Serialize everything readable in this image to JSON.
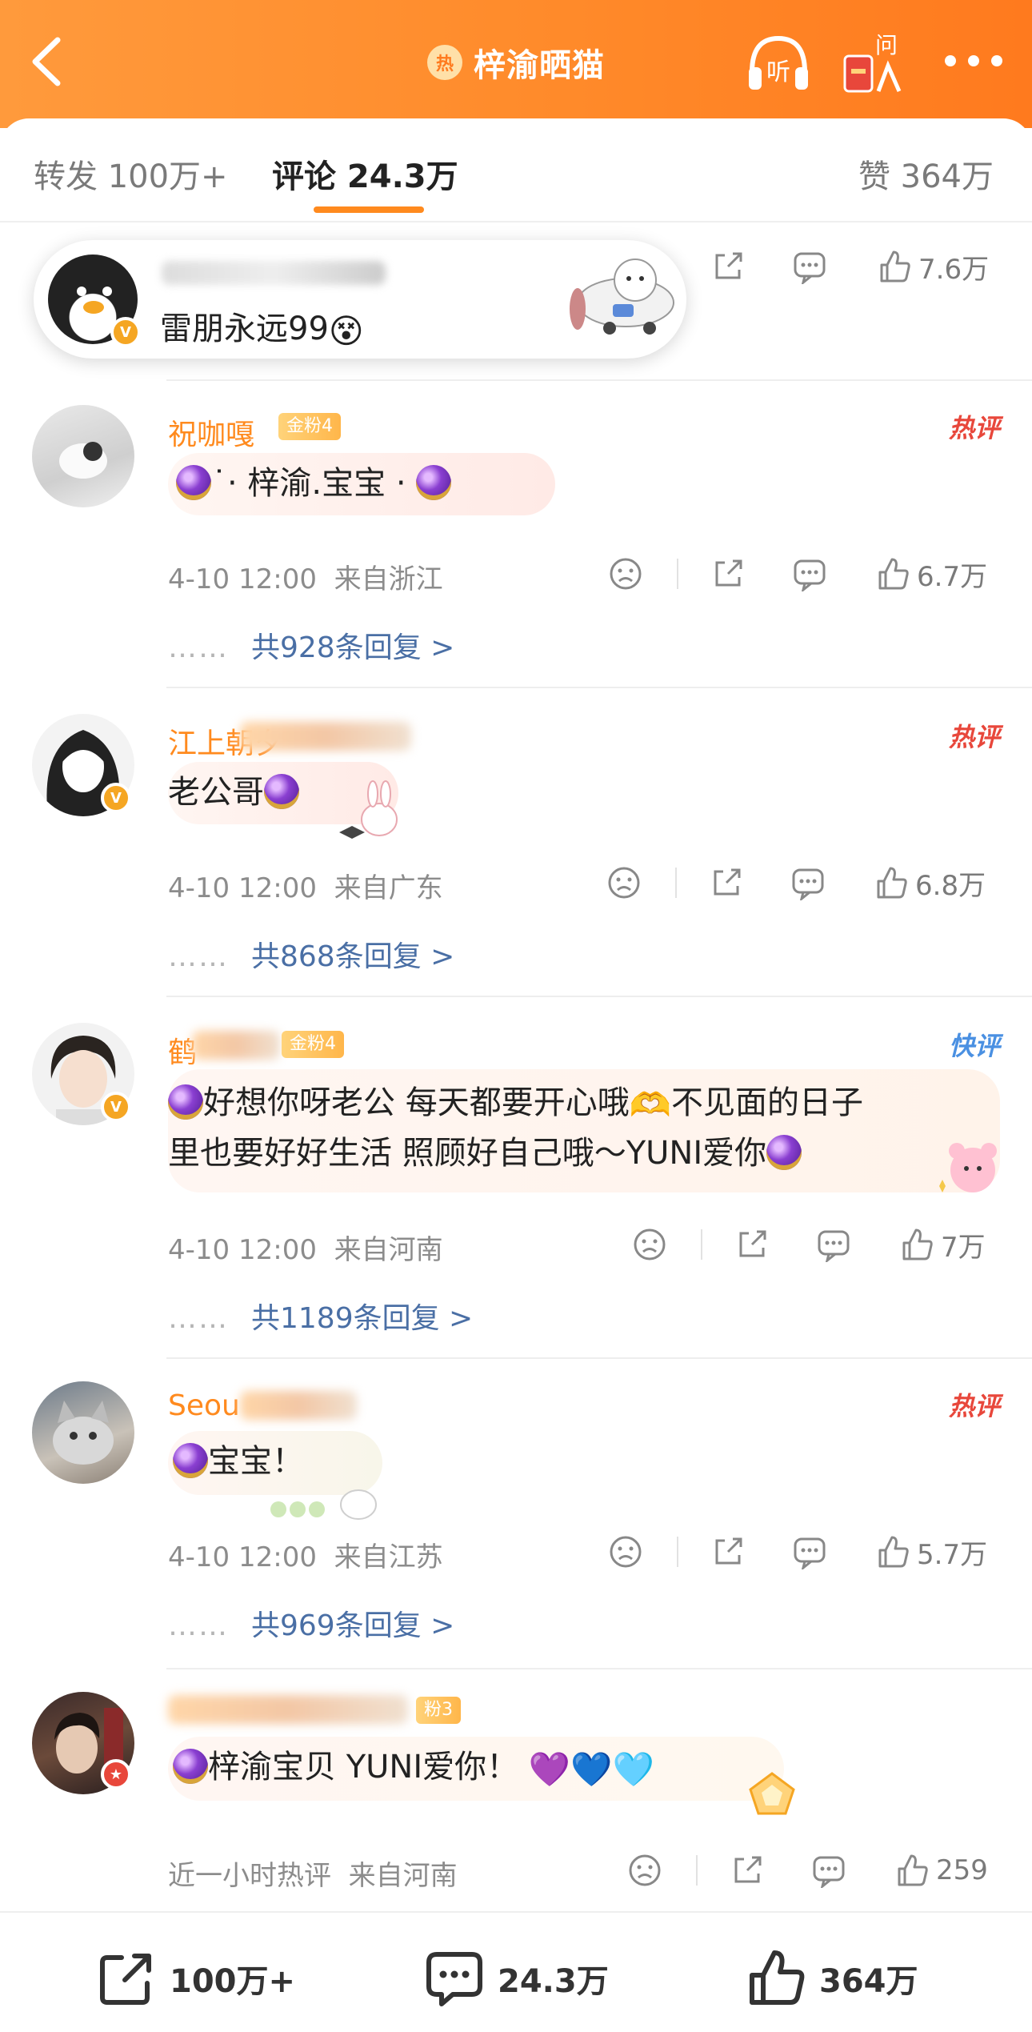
{
  "header": {
    "title": "梓渝晒猫",
    "hot_badge": "热",
    "ask_label": "问",
    "listen_label": "听",
    "gradient": [
      "#ff9a3c",
      "#ff7a1e"
    ]
  },
  "tabs": {
    "repost": "转发 100万+",
    "comment": "评论 24.3万",
    "like": "赞 364万",
    "active_color": "#ff8a1e"
  },
  "pill": {
    "text": "雷朋永远99",
    "like_count": "7.6万"
  },
  "comments": [
    {
      "name": "祝咖嘎",
      "fan_badge": "金粉4",
      "tag": "热评",
      "text": "˙· 梓渝.宝宝 ·",
      "time": "4-10 12:00",
      "location": "来自浙江",
      "likes": "6.7万",
      "replies": "共928条回复 >"
    },
    {
      "name": "江上朝夕",
      "tag": "热评",
      "text": "老公哥",
      "time": "4-10 12:00",
      "location": "来自广东",
      "likes": "6.8万",
      "replies": "共868条回复 >"
    },
    {
      "name": "鹤",
      "fan_badge": "金粉4",
      "tag": "快评",
      "text_line1": "好想你呀老公 每天都要开心哦",
      "text_line1b": "不见面的日子",
      "text_line2": "里也要好好生活 照顾好自己哦～YUNI爱你",
      "time": "4-10 12:00",
      "location": "来自河南",
      "likes": "7万",
      "replies": "共1189条回复 >"
    },
    {
      "name": "Seou",
      "tag": "热评",
      "text": "宝宝！",
      "time": "4-10 12:00",
      "location": "来自江苏",
      "likes": "5.7万",
      "replies": "共969条回复 >"
    },
    {
      "name": "",
      "fan_badge": "粉3",
      "text": "梓渝宝贝 YUNI爱你！",
      "time": "近一小时热评",
      "location": "来自河南",
      "likes": "259"
    }
  ],
  "reply_dots": "……",
  "bottom": {
    "repost": "100万+",
    "comment": "24.3万",
    "like": "364万"
  },
  "icons": [
    "back-icon",
    "listen-icon",
    "ask-redpacket-icon",
    "more-icon",
    "share-icon",
    "comment-icon",
    "like-icon",
    "dislike-icon"
  ]
}
